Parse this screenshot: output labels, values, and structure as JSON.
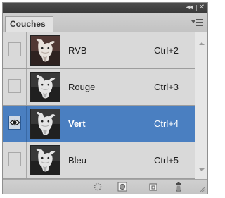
{
  "window": {
    "collapse_glyph": "◂◂",
    "close_glyph": "✕"
  },
  "tab": {
    "label": "Couches"
  },
  "channels": [
    {
      "name": "RVB",
      "shortcut": "Ctrl+2",
      "visible": false,
      "selected": false,
      "thumb": "rgb"
    },
    {
      "name": "Rouge",
      "shortcut": "Ctrl+3",
      "visible": false,
      "selected": false,
      "thumb": "gray"
    },
    {
      "name": "Vert",
      "shortcut": "Ctrl+4",
      "visible": true,
      "selected": true,
      "thumb": "gray"
    },
    {
      "name": "Bleu",
      "shortcut": "Ctrl+5",
      "visible": false,
      "selected": false,
      "thumb": "gray"
    }
  ],
  "footer_icons": [
    "dotted-circle-icon",
    "mask-circle-icon",
    "new-channel-icon",
    "trash-icon"
  ],
  "colors": {
    "selection": "#4a7fc1",
    "panel": "#d6d6d6",
    "row": "#d9d9d9"
  }
}
